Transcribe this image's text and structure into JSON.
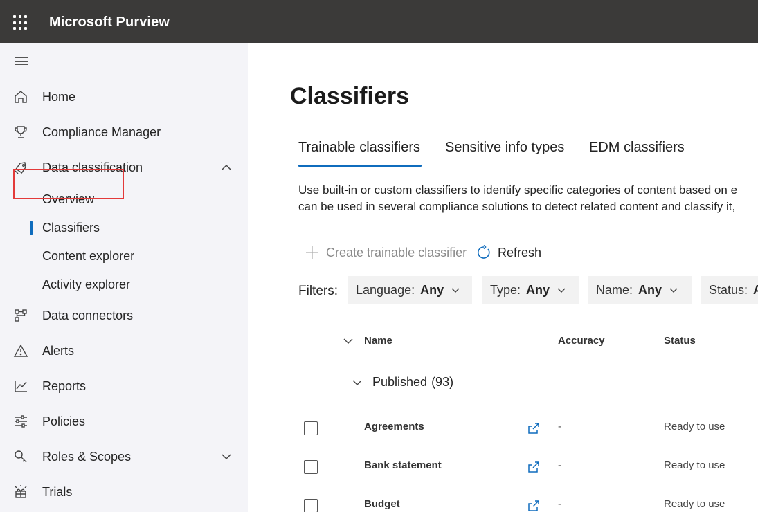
{
  "app": {
    "title": "Microsoft Purview"
  },
  "nav": {
    "items": [
      {
        "label": "Home",
        "icon": "home-icon"
      },
      {
        "label": "Compliance Manager",
        "icon": "trophy-icon"
      },
      {
        "label": "Data classification",
        "icon": "tag-icon",
        "expanded": true
      },
      {
        "label": "Data connectors",
        "icon": "connector-icon"
      },
      {
        "label": "Alerts",
        "icon": "warning-icon"
      },
      {
        "label": "Reports",
        "icon": "chart-icon"
      },
      {
        "label": "Policies",
        "icon": "sliders-icon"
      },
      {
        "label": "Roles & Scopes",
        "icon": "key-search-icon",
        "expanded": false
      },
      {
        "label": "Trials",
        "icon": "trials-icon"
      }
    ],
    "sub_items": [
      {
        "label": "Overview"
      },
      {
        "label": "Classifiers",
        "selected": true
      },
      {
        "label": "Content explorer"
      },
      {
        "label": "Activity explorer"
      }
    ]
  },
  "main": {
    "title": "Classifiers",
    "tabs": [
      {
        "label": "Trainable classifiers",
        "active": true
      },
      {
        "label": "Sensitive info types"
      },
      {
        "label": "EDM classifiers"
      }
    ],
    "description_line1": "Use built-in or custom classifiers to identify specific categories of content based on e",
    "description_line2": "can be used in several compliance solutions to detect related content and classify it,",
    "commands": {
      "create_label": "Create trainable classifier",
      "refresh_label": "Refresh"
    },
    "filters_label": "Filters:",
    "filters": [
      {
        "name": "Language:",
        "value": "Any"
      },
      {
        "name": "Type:",
        "value": "Any"
      },
      {
        "name": "Name:",
        "value": "Any"
      },
      {
        "name": "Status:",
        "value": "A"
      }
    ],
    "columns": {
      "name": "Name",
      "accuracy": "Accuracy",
      "status": "Status"
    },
    "group": {
      "label": "Published",
      "count": "(93)"
    },
    "rows": [
      {
        "name": "Agreements",
        "accuracy": "-",
        "status": "Ready to use"
      },
      {
        "name": "Bank statement",
        "accuracy": "-",
        "status": "Ready to use"
      },
      {
        "name": "Budget",
        "accuracy": "-",
        "status": "Ready to use"
      }
    ]
  },
  "colors": {
    "topbar": "#3b3a39",
    "nav_bg": "#f4f4f8",
    "accent": "#0f6cbd",
    "highlight": "#e33a3a"
  }
}
